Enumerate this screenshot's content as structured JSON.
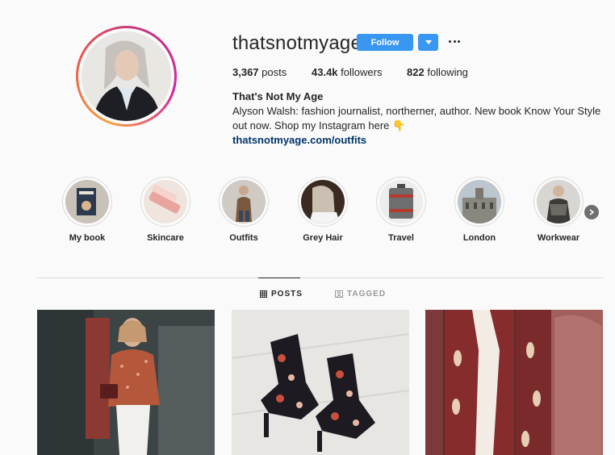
{
  "profile": {
    "username": "thatsnotmyage",
    "follow_label": "Follow",
    "dropdown_icon": "caret-down-icon",
    "more_icon": "ellipsis-icon"
  },
  "stats": {
    "posts_count": "3,367",
    "posts_label": "posts",
    "followers_count": "43.4k",
    "followers_label": "followers",
    "following_count": "822",
    "following_label": "following"
  },
  "bio": {
    "name": "That's Not My Age",
    "text": "Alyson Walsh: fashion journalist, northerner, author. New book Know Your Style out now. Shop my Instagram here 👇",
    "link": "thatsnotmyage.com/outfits"
  },
  "highlights": [
    {
      "label": "My book"
    },
    {
      "label": "Skincare"
    },
    {
      "label": "Outfits"
    },
    {
      "label": "Grey Hair"
    },
    {
      "label": "Travel"
    },
    {
      "label": "London"
    },
    {
      "label": "Workwear"
    }
  ],
  "tabs": {
    "posts": "POSTS",
    "tagged": "TAGGED"
  },
  "colors": {
    "accent": "#3897f0",
    "link": "#003569",
    "text": "#262626",
    "muted": "#999999",
    "background": "#fafafa"
  }
}
